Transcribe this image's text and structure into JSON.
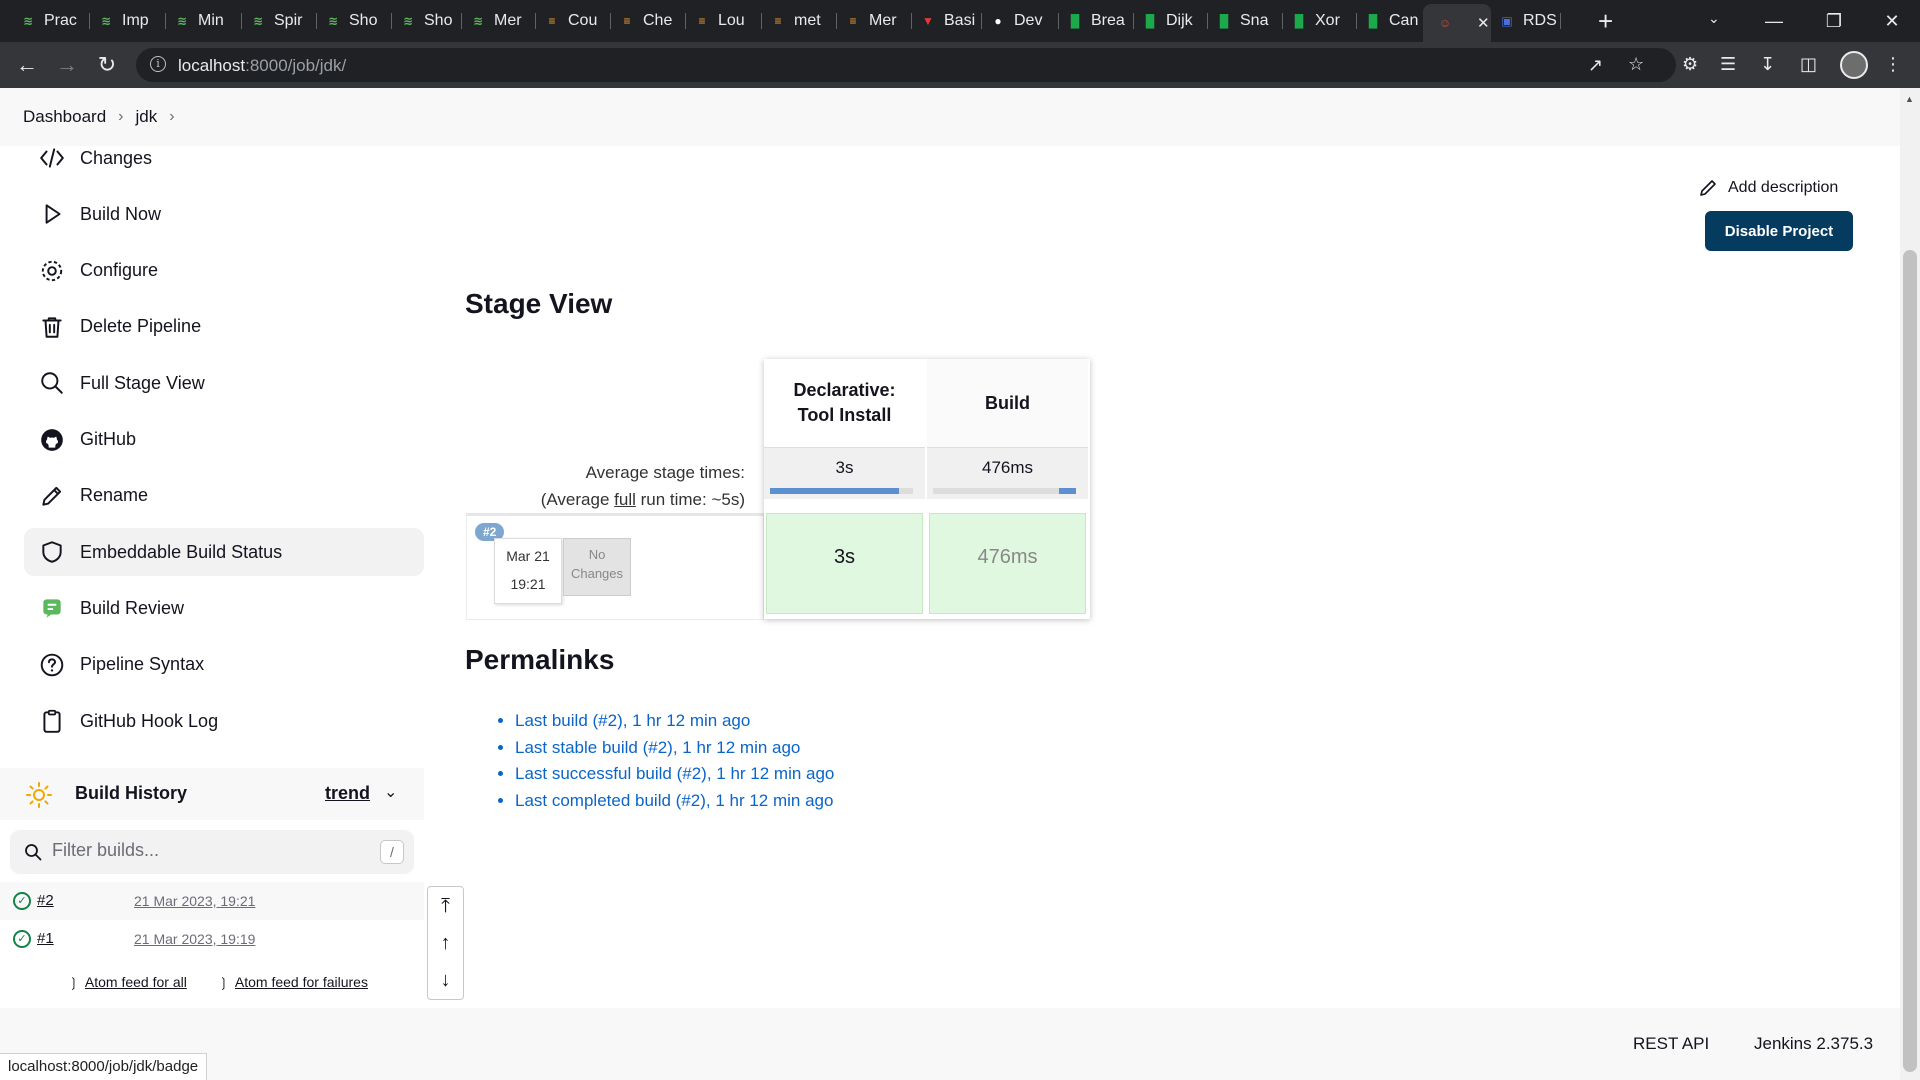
{
  "browser": {
    "tabs": [
      {
        "label": "Prac",
        "favicon": "leetcode-icon",
        "color": "#5cb85c"
      },
      {
        "label": "Imp",
        "favicon": "leetcode-icon",
        "color": "#5cb85c"
      },
      {
        "label": "Min",
        "favicon": "leetcode-icon",
        "color": "#5cb85c"
      },
      {
        "label": "Spir",
        "favicon": "leetcode-icon",
        "color": "#5cb85c"
      },
      {
        "label": "Sho",
        "favicon": "leetcode-icon",
        "color": "#5cb85c"
      },
      {
        "label": "Sho",
        "favicon": "leetcode-icon",
        "color": "#5cb85c"
      },
      {
        "label": "Mer",
        "favicon": "leetcode-icon",
        "color": "#5cb85c"
      },
      {
        "label": "Cou",
        "favicon": "codeforces-icon",
        "color": "#f0a030"
      },
      {
        "label": "Che",
        "favicon": "codeforces-icon",
        "color": "#f0a030"
      },
      {
        "label": "Lou",
        "favicon": "codeforces-icon",
        "color": "#f0a030"
      },
      {
        "label": "met",
        "favicon": "codeforces-icon",
        "color": "#f0a030"
      },
      {
        "label": "Mer",
        "favicon": "codeforces-icon",
        "color": "#f0a030"
      },
      {
        "label": "Basi",
        "favicon": "vercel-icon",
        "color": "#e53935"
      },
      {
        "label": "Dev",
        "favicon": "github-icon",
        "color": "#ffffff"
      },
      {
        "label": "Brea",
        "favicon": "hackerrank-icon",
        "color": "#1ba94c"
      },
      {
        "label": "Dijk",
        "favicon": "hackerrank-icon",
        "color": "#1ba94c"
      },
      {
        "label": "Sna",
        "favicon": "hackerrank-icon",
        "color": "#1ba94c"
      },
      {
        "label": "Xor",
        "favicon": "hackerrank-icon",
        "color": "#1ba94c"
      },
      {
        "label": "Can",
        "favicon": "hackerrank-icon",
        "color": "#1ba94c"
      },
      {
        "label": "",
        "favicon": "jenkins-icon",
        "color": "#d24939",
        "active": true
      },
      {
        "label": "RDS",
        "favicon": "aws-rds-icon",
        "color": "#4a6fdc"
      }
    ],
    "close_glyph": "✕",
    "new_tab_glyph": "+",
    "url_host": "localhost",
    "url_rest": ":8000/job/jdk/"
  },
  "breadcrumb": {
    "items": [
      "Dashboard",
      "jdk"
    ]
  },
  "sidebar": {
    "tasks": [
      {
        "label": "Changes",
        "icon": "code-icon"
      },
      {
        "label": "Build Now",
        "icon": "play-icon"
      },
      {
        "label": "Configure",
        "icon": "gear-icon"
      },
      {
        "label": "Delete Pipeline",
        "icon": "trash-icon"
      },
      {
        "label": "Full Stage View",
        "icon": "search-icon"
      },
      {
        "label": "GitHub",
        "icon": "github-icon"
      },
      {
        "label": "Rename",
        "icon": "pencil-icon"
      },
      {
        "label": "Embeddable Build Status",
        "icon": "shield-icon"
      },
      {
        "label": "Build Review",
        "icon": "review-icon"
      },
      {
        "label": "Pipeline Syntax",
        "icon": "help-icon"
      },
      {
        "label": "GitHub Hook Log",
        "icon": "clipboard-icon"
      }
    ]
  },
  "build_history": {
    "title": "Build History",
    "trend": "trend",
    "filter_placeholder": "Filter builds...",
    "filter_shortcut": "/",
    "builds": [
      {
        "number": "#2",
        "date": "21 Mar 2023, 19:21",
        "status": "success"
      },
      {
        "number": "#1",
        "date": "21 Mar 2023, 19:19",
        "status": "success"
      }
    ],
    "feed_all": "Atom feed for all",
    "feed_failures": "Atom feed for failures"
  },
  "main": {
    "add_description": "Add description",
    "disable_project": "Disable Project",
    "stage_view_title": "Stage View",
    "stages": [
      {
        "name_line1": "Declarative:",
        "name_line2": "Tool Install",
        "avg": "3s",
        "avg_fraction": 0.9,
        "result": "3s"
      },
      {
        "name_line1": "Build",
        "name_line2": "",
        "avg": "476ms",
        "avg_fraction": 0.12,
        "result": "476ms"
      }
    ],
    "avg_stage_times": "Average stage times:",
    "avg_full_prefix": "(Average ",
    "avg_full_link": "full",
    "avg_full_suffix": " run time: ~5s)",
    "run": {
      "badge": "#2",
      "date": "Mar 21",
      "time": "19:21",
      "changes_line1": "No",
      "changes_line2": "Changes"
    },
    "permalinks_title": "Permalinks",
    "permalinks": [
      "Last build (#2), 1 hr 12 min ago",
      "Last stable build (#2), 1 hr 12 min ago",
      "Last successful build (#2), 1 hr 12 min ago",
      "Last completed build (#2), 1 hr 12 min ago"
    ]
  },
  "footer": {
    "rest_api": "REST API",
    "version": "Jenkins 2.375.3"
  },
  "status_url": "localhost:8000/job/jdk/badge"
}
